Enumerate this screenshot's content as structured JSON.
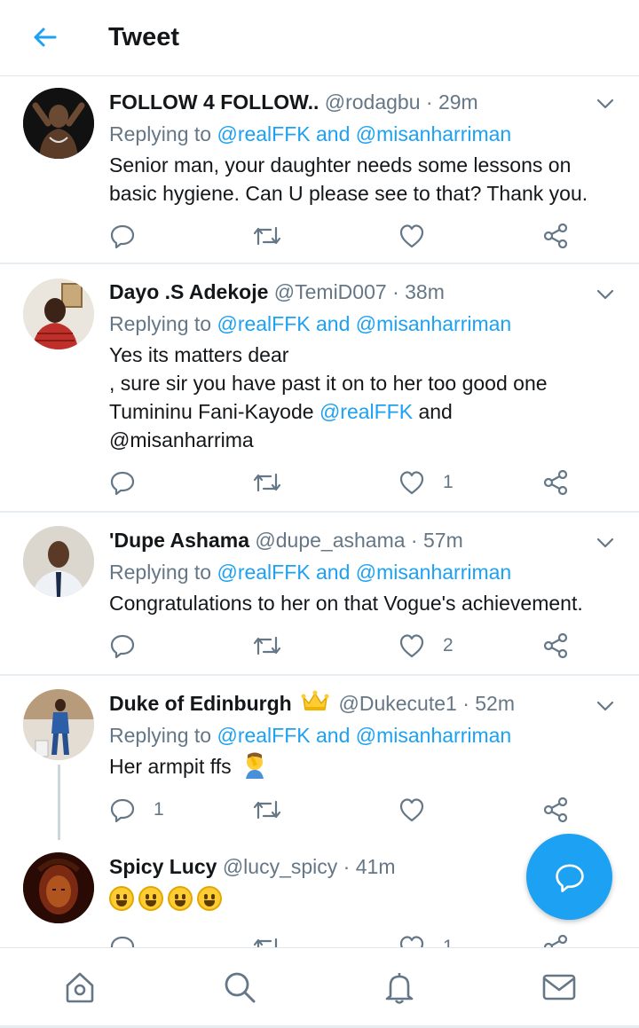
{
  "header": {
    "title": "Tweet"
  },
  "tweets": [
    {
      "name": "FOLLOW 4 FOLLOW..",
      "handle": "@rodagbu",
      "time": "29m",
      "replying_prefix": "Replying to",
      "mention1": "@realFFK",
      "and": "and",
      "mention2": "@misanharriman",
      "text_lines": [
        "Senior man, your daughter needs some lessons on",
        "basic hygiene. Can U please see to that? Thank you."
      ],
      "reply_count": "",
      "retweet_count": "",
      "like_count": ""
    },
    {
      "name": "Dayo .S Adekoje",
      "handle": "@TemiD007",
      "time": "38m",
      "replying_prefix": "Replying to",
      "mention1": "@realFFK",
      "and": "and",
      "mention2": "@misanharriman",
      "text_lines": [
        "Yes its matters dear",
        ", sure sir you have past it on to her too good one",
        "Tumininu Fani-Kayode",
        "@realFFK",
        "and",
        "@misanharrima"
      ],
      "reply_count": "",
      "retweet_count": "",
      "like_count": "1"
    },
    {
      "name": "'Dupe Ashama",
      "handle": "@dupe_ashama",
      "time": "57m",
      "replying_prefix": "Replying to",
      "mention1": "@realFFK",
      "and": "and",
      "mention2": "@misanharriman",
      "text_lines": [
        "Congratulations to her on that Vogue's achievement."
      ],
      "reply_count": "",
      "retweet_count": "",
      "like_count": "2"
    },
    {
      "name": "Duke of Edinburgh",
      "handle": "@Dukecute1",
      "time": "52m",
      "replying_prefix": "Replying to",
      "mention1": "@realFFK",
      "and": "and",
      "mention2": "@misanharriman",
      "text_lines": [
        "Her armpit ffs"
      ],
      "reply_count": "1",
      "retweet_count": "",
      "like_count": ""
    },
    {
      "name": "Spicy Lucy",
      "handle": "@lucy_spicy",
      "time": "41m",
      "text_lines": [],
      "reply_count": "",
      "retweet_count": "",
      "like_count": "1"
    }
  ],
  "separator": "·",
  "icons": {
    "back": "arrow-left-icon",
    "caret": "chevron-down-icon",
    "reply": "reply-icon",
    "retweet": "retweet-icon",
    "like": "heart-icon",
    "share": "share-icon",
    "compose": "compose-reply-icon",
    "home": "home-icon",
    "search": "search-icon",
    "notifications": "bell-icon",
    "messages": "mail-icon"
  },
  "colors": {
    "accent": "#1da1f2",
    "text": "#14171a",
    "secondary": "#657786",
    "divider": "#e6ecf0"
  }
}
